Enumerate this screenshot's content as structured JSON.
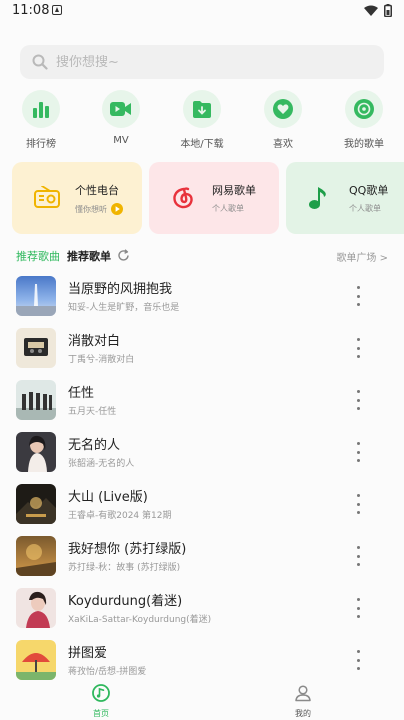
{
  "status_bar": {
    "time": "11:08"
  },
  "search": {
    "placeholder": "搜你想搜~"
  },
  "quick_actions": [
    {
      "label": "排行榜",
      "icon": "chart-bars-icon"
    },
    {
      "label": "MV",
      "icon": "video-icon"
    },
    {
      "label": "本地/下载",
      "icon": "download-folder-icon"
    },
    {
      "label": "喜欢",
      "icon": "heart-icon"
    },
    {
      "label": "我的歌单",
      "icon": "disc-icon"
    }
  ],
  "cards": [
    {
      "title": "个性电台",
      "subtitle": "懂你想听",
      "icon": "radio-icon",
      "bg": "#fdf1d2"
    },
    {
      "title": "网易歌单",
      "subtitle": "个人歌单",
      "icon": "netease-icon",
      "bg": "#fde6e8"
    },
    {
      "title": "QQ歌单",
      "subtitle": "个人歌单",
      "icon": "music-note-icon",
      "bg": "#e3f3e6"
    }
  ],
  "section": {
    "tab_active": "推荐歌曲",
    "tab_other": "推荐歌单",
    "more_link": "歌单广场 >"
  },
  "songs": [
    {
      "title": "当原野的风拥抱我",
      "subtitle": "知妥-人生是旷野，音乐也是"
    },
    {
      "title": "消散对白",
      "subtitle": "丁禹兮-消散对白"
    },
    {
      "title": "任性",
      "subtitle": "五月天-任性"
    },
    {
      "title": "无名的人",
      "subtitle": "张韶涵-无名的人"
    },
    {
      "title": "大山 (Live版)",
      "subtitle": "王睿卓-有歌2024 第12期"
    },
    {
      "title": "我好想你 (苏打绿版)",
      "subtitle": "苏打绿-秋：故事 (苏打绿版)"
    },
    {
      "title": "Koydurdung(着迷)",
      "subtitle": "XaKiLa-Sattar-Koydurdung(着迷)"
    },
    {
      "title": "拼图爱",
      "subtitle": "蒋孜怡/岳想-拼图爱"
    }
  ],
  "bottom_nav": [
    {
      "label": "首页",
      "active": true
    },
    {
      "label": "我的",
      "active": false
    }
  ],
  "colors": {
    "accent": "#2fb85d",
    "accent_light": "#e7f5ea",
    "netease_red": "#e8323c"
  }
}
